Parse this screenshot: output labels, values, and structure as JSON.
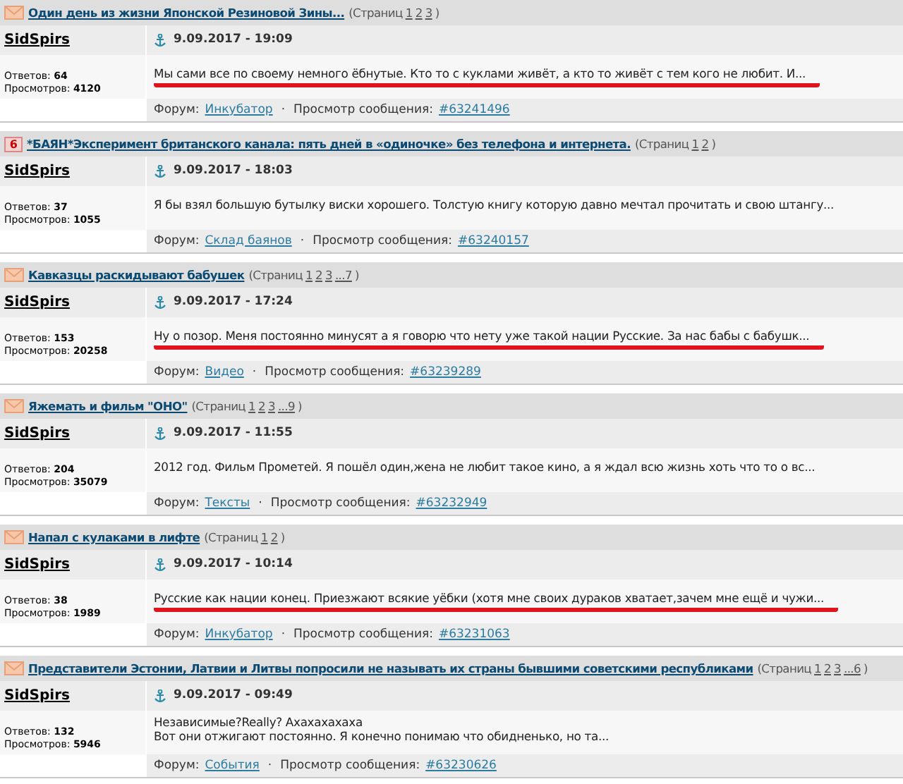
{
  "posts": [
    {
      "kind": "envelope",
      "title": "Один день из жизни Японской Резиновой Зины...",
      "pages_label": "(Страниц",
      "pages": [
        "1",
        "2",
        "3"
      ],
      "pages_close": ")",
      "author": "SidSpirs",
      "date": "9.09.2017 - 19:09",
      "replies_label": "Ответов:",
      "replies": "64",
      "views_label": "Просмотров:",
      "views": "4120",
      "body": [
        "Мы сами все по своему немного ёбнутые. Кто то с куклами живёт, а кто то живёт с тем кого не любит. И..."
      ],
      "underlined": true,
      "forum_label": "Форум:",
      "forum": "Инкубатор",
      "sep": "·",
      "message_label": "Просмотр сообщения:",
      "message": "#63241496"
    },
    {
      "kind": "badge",
      "icon_text": "6",
      "title": "*БАЯН*Эксперимент британского канала: пять дней в «одиночке» без телефона и интернета.",
      "pages_label": "(Страниц",
      "pages": [
        "1",
        "2"
      ],
      "pages_close": ")",
      "author": "SidSpirs",
      "date": "9.09.2017 - 18:03",
      "replies_label": "Ответов:",
      "replies": "37",
      "views_label": "Просмотров:",
      "views": "1055",
      "body": [
        "Я бы взял большую бутылку виски хорошего. Толстую книгу которую давно мечтал прочитать и свою штангу..."
      ],
      "underlined": false,
      "forum_label": "Форум:",
      "forum": "Склад баянов",
      "sep": "·",
      "message_label": "Просмотр сообщения:",
      "message": "#63240157"
    },
    {
      "kind": "envelope",
      "title": "Кавказцы раскидывают бабушек",
      "pages_label": "(Страниц",
      "pages": [
        "1",
        "2",
        "3",
        "...7"
      ],
      "pages_close": ")",
      "author": "SidSpirs",
      "date": "9.09.2017 - 17:24",
      "replies_label": "Ответов:",
      "replies": "153",
      "views_label": "Просмотров:",
      "views": "20258",
      "body": [
        "Ну о позор. Меня постоянно минусят а я говорю что нету уже такой нации Русские. За нас бабы с бабушк..."
      ],
      "underlined": true,
      "forum_label": "Форум:",
      "forum": "Видео",
      "sep": "·",
      "message_label": "Просмотр сообщения:",
      "message": "#63239289"
    },
    {
      "kind": "envelope",
      "title": "Яжемать и фильм \"ОНО\"",
      "pages_label": "(Страниц",
      "pages": [
        "1",
        "2",
        "3",
        "...9"
      ],
      "pages_close": ")",
      "author": "SidSpirs",
      "date": "9.09.2017 - 11:55",
      "replies_label": "Ответов:",
      "replies": "204",
      "views_label": "Просмотров:",
      "views": "35079",
      "body": [
        "2012 год. Фильм Прометей. Я пошёл один,жена не любит такое кино, а я ждал всю жизнь хоть что то о вс..."
      ],
      "underlined": false,
      "forum_label": "Форум:",
      "forum": "Тексты",
      "sep": "·",
      "message_label": "Просмотр сообщения:",
      "message": "#63232949"
    },
    {
      "kind": "envelope",
      "title": "Напал с кулаками в лифте",
      "pages_label": "(Страниц",
      "pages": [
        "1",
        "2"
      ],
      "pages_close": ")",
      "author": "SidSpirs",
      "date": "9.09.2017 - 10:14",
      "replies_label": "Ответов:",
      "replies": "38",
      "views_label": "Просмотров:",
      "views": "1989",
      "body": [
        "Русские как нации конец. Приезжают всякие уёбки (хотя мне своих дураков хватает,зачем мне ещё и чужи..."
      ],
      "underlined": true,
      "forum_label": "Форум:",
      "forum": "Инкубатор",
      "sep": "·",
      "message_label": "Просмотр сообщения:",
      "message": "#63231063"
    },
    {
      "kind": "envelope",
      "title": "Представители Эстонии, Латвии и Литвы попросили не называть их страны бывшими советскими республиками",
      "pages_label": "(Страниц",
      "pages": [
        "1",
        "2",
        "3",
        "...6"
      ],
      "pages_close": ")",
      "author": "SidSpirs",
      "date": "9.09.2017 - 09:49",
      "replies_label": "Ответов:",
      "replies": "132",
      "views_label": "Просмотров:",
      "views": "5946",
      "body": [
        "Независимые?Really? Ахахахахаха",
        "Вот они отжигают постоянно. Я конечно понимаю что обидненько, но та..."
      ],
      "underlined": false,
      "forum_label": "Форум:",
      "forum": "События",
      "sep": "·",
      "message_label": "Просмотр сообщения:",
      "message": "#63230626"
    }
  ]
}
